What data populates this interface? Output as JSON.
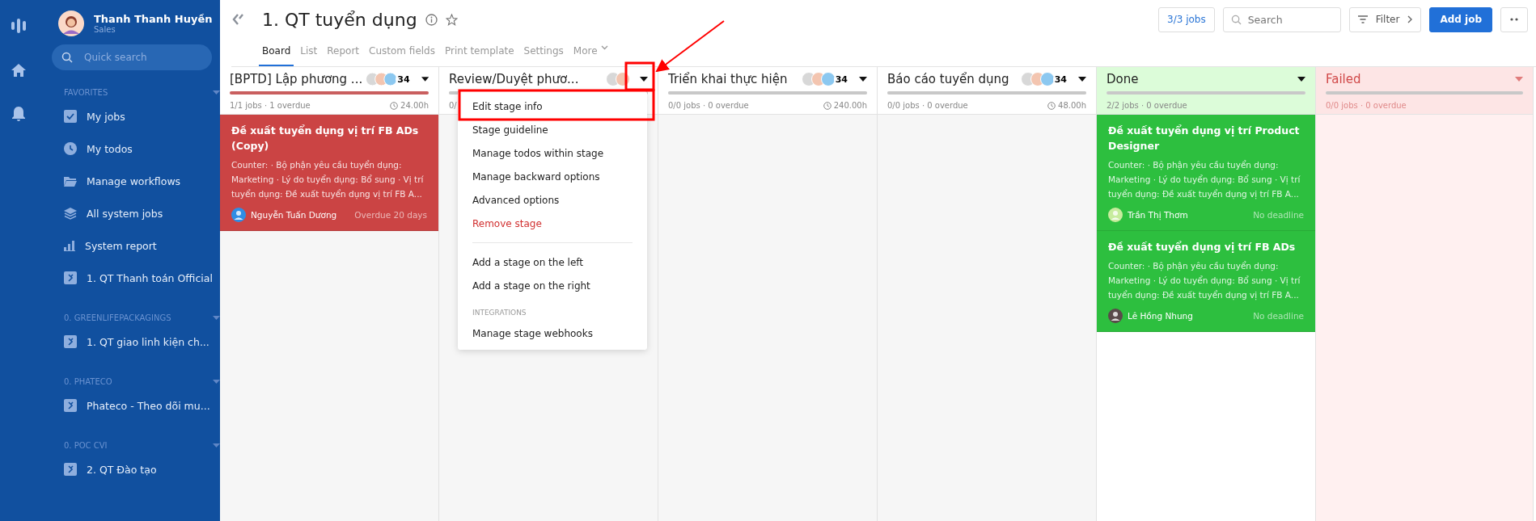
{
  "user": {
    "name": "Thanh Thanh Huyền",
    "role": "Sales"
  },
  "quick_search": {
    "placeholder": "Quick search"
  },
  "sidebar_sections": [
    {
      "title": "FAVORITES",
      "items": [
        {
          "label": "My jobs",
          "kind": "check"
        },
        {
          "label": "My todos",
          "kind": "clock"
        },
        {
          "label": "Manage workflows",
          "kind": "folder"
        },
        {
          "label": "All system jobs",
          "kind": "layers"
        },
        {
          "label": "System report",
          "kind": "chart"
        },
        {
          "label": "1. QT Thanh toán Official",
          "kind": "workflow"
        }
      ]
    },
    {
      "title": "0. GREENLIFEPACKAGINGS",
      "items": [
        {
          "label": "1. QT giao linh kiện ch...",
          "kind": "workflow"
        }
      ]
    },
    {
      "title": "0. PHATECO",
      "items": [
        {
          "label": "Phateco - Theo dõi mu...",
          "kind": "workflow"
        }
      ]
    },
    {
      "title": "0. POC CVI",
      "items": [
        {
          "label": "2. QT Đào tạo",
          "kind": "workflow"
        }
      ]
    }
  ],
  "page": {
    "title": "1. QT tuyển dụng"
  },
  "tabs": [
    {
      "label": "Board",
      "selected": true
    },
    {
      "label": "List",
      "selected": false
    },
    {
      "label": "Report",
      "selected": false
    },
    {
      "label": "Custom fields",
      "selected": false
    },
    {
      "label": "Print template",
      "selected": false
    },
    {
      "label": "Settings",
      "selected": false
    },
    {
      "label": "More",
      "selected": false
    }
  ],
  "toolbar": {
    "jobs_count": "3/3 jobs",
    "search_placeholder": "Search",
    "filter": "Filter",
    "add_job": "Add job"
  },
  "stages": [
    {
      "name": "[BPTD] Lập phương ...",
      "kind": "normal",
      "members": true,
      "count": "34",
      "level": 1,
      "overdue": true,
      "stats": "1/1 jobs · 1 overdue",
      "hours": "24.00h",
      "cards": [
        {
          "title": "Đề xuất tuyển dụng vị trí FB ADs (Copy)",
          "description": "Counter: · Bộ phận yêu cầu tuyển dụng: Marketing · Lý do tuyển dụng: Bổ sung · Vị trí tuyển dụng: Đề xuất tuyển dụng vị trí FB A...",
          "assignee": "Nguyễn Tuấn Dương",
          "due": "Overdue 20 days",
          "color": "#cb4444"
        }
      ]
    },
    {
      "name": "Review/Duyệt phươ...",
      "kind": "normal",
      "members": true,
      "level": 1,
      "overdue": false,
      "stats": "0/"
    },
    {
      "name": "Triển khai thực hiện",
      "kind": "normal",
      "members": true,
      "count": "34",
      "level": 1,
      "overdue": false,
      "stats": "0/0 jobs · 0 overdue",
      "hours": "240.00h"
    },
    {
      "name": "Báo cáo tuyển dụng",
      "kind": "normal",
      "members": true,
      "count": "34",
      "level": 1,
      "overdue": false,
      "stats": "0/0 jobs · 0 overdue",
      "hours": "48.00h"
    },
    {
      "name": "Done",
      "kind": "done",
      "members": false,
      "level": 1,
      "overdue": false,
      "stats": "2/2 jobs · 0 overdue",
      "cards": [
        {
          "title": "Đề xuất tuyển dụng vị trí Product Designer",
          "description": "Counter: · Bộ phận yêu cầu tuyển dụng: Marketing · Lý do tuyển dụng: Bổ sung · Vị trí tuyển dụng: Đề xuất tuyển dụng vị trí FB A...",
          "assignee": "Trần Thị Thơm",
          "due": "No deadline",
          "color": "#2dbf3f"
        },
        {
          "title": "Đề xuất tuyển dụng vị trí FB ADs",
          "description": "Counter: · Bộ phận yêu cầu tuyển dụng: Marketing · Lý do tuyển dụng: Bổ sung · Vị trí tuyển dụng: Đề xuất tuyển dụng vị trí FB A...",
          "assignee": "Lê Hồng Nhung",
          "due": "No deadline",
          "color": "#2dbf3f"
        }
      ]
    },
    {
      "name": "Failed",
      "kind": "failed",
      "members": false,
      "level": 1,
      "overdue": false,
      "stats": "0/0 jobs · 0 overdue"
    }
  ],
  "stage_menu": {
    "items": [
      {
        "label": "Edit stage info",
        "kind": "item"
      },
      {
        "label": "Stage guideline",
        "kind": "item"
      },
      {
        "label": "Manage todos within stage",
        "kind": "item"
      },
      {
        "label": "Manage backward options",
        "kind": "item"
      },
      {
        "label": "Advanced options",
        "kind": "item"
      },
      {
        "label": "Remove stage",
        "kind": "danger"
      },
      {
        "kind": "divider"
      },
      {
        "label": "Add a stage on the left",
        "kind": "item"
      },
      {
        "label": "Add a stage on the right",
        "kind": "item"
      },
      {
        "label": "INTEGRATIONS",
        "kind": "heading"
      },
      {
        "label": "Manage stage webhooks",
        "kind": "item"
      }
    ]
  }
}
